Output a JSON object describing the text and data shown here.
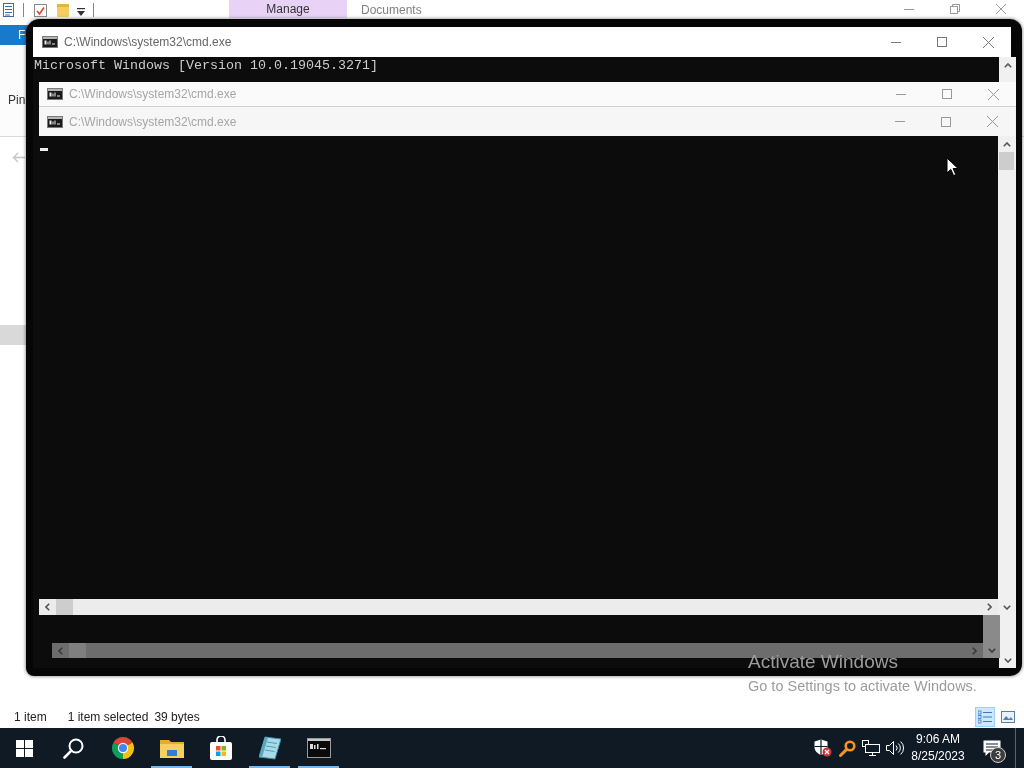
{
  "explorer": {
    "title": "Documents",
    "context_tab_group": "Manage",
    "file_tab": "F",
    "ribbon_labels": [
      "Pin"
    ],
    "status_bar": {
      "items": "1 item",
      "selection": "1 item selected",
      "size": "39 bytes"
    },
    "view_buttons": [
      {
        "kind": "details",
        "selected": true
      },
      {
        "kind": "large-icons",
        "selected": false
      }
    ]
  },
  "consoles": [
    {
      "title": "C:\\Windows\\system32\\cmd.exe",
      "lines": [
        "Microsoft Windows [Version 10.0.19045.3271]"
      ],
      "cursor": false
    },
    {
      "title": "C:\\Windows\\system32\\cmd.exe"
    },
    {
      "title": "C:\\Windows\\system32\\cmd.exe",
      "cursor": true
    }
  ],
  "activation_notice": {
    "title": "Activate Windows",
    "hint": "Go to Settings to activate Windows."
  },
  "taskbar": {
    "apps": [
      {
        "kind": "start",
        "running": false
      },
      {
        "kind": "search",
        "running": false
      },
      {
        "kind": "browser",
        "running": false
      },
      {
        "kind": "folder",
        "running": true
      },
      {
        "kind": "store",
        "running": false
      },
      {
        "kind": "notebook",
        "running": true
      },
      {
        "kind": "terminal",
        "running": true
      }
    ],
    "tray": [
      {
        "kind": "shield"
      },
      {
        "kind": "magnifier"
      },
      {
        "kind": "network"
      },
      {
        "kind": "volume"
      }
    ],
    "clock": {
      "time": "9:06 AM",
      "date": "8/25/2023"
    },
    "notifications": {
      "count": "3"
    }
  }
}
